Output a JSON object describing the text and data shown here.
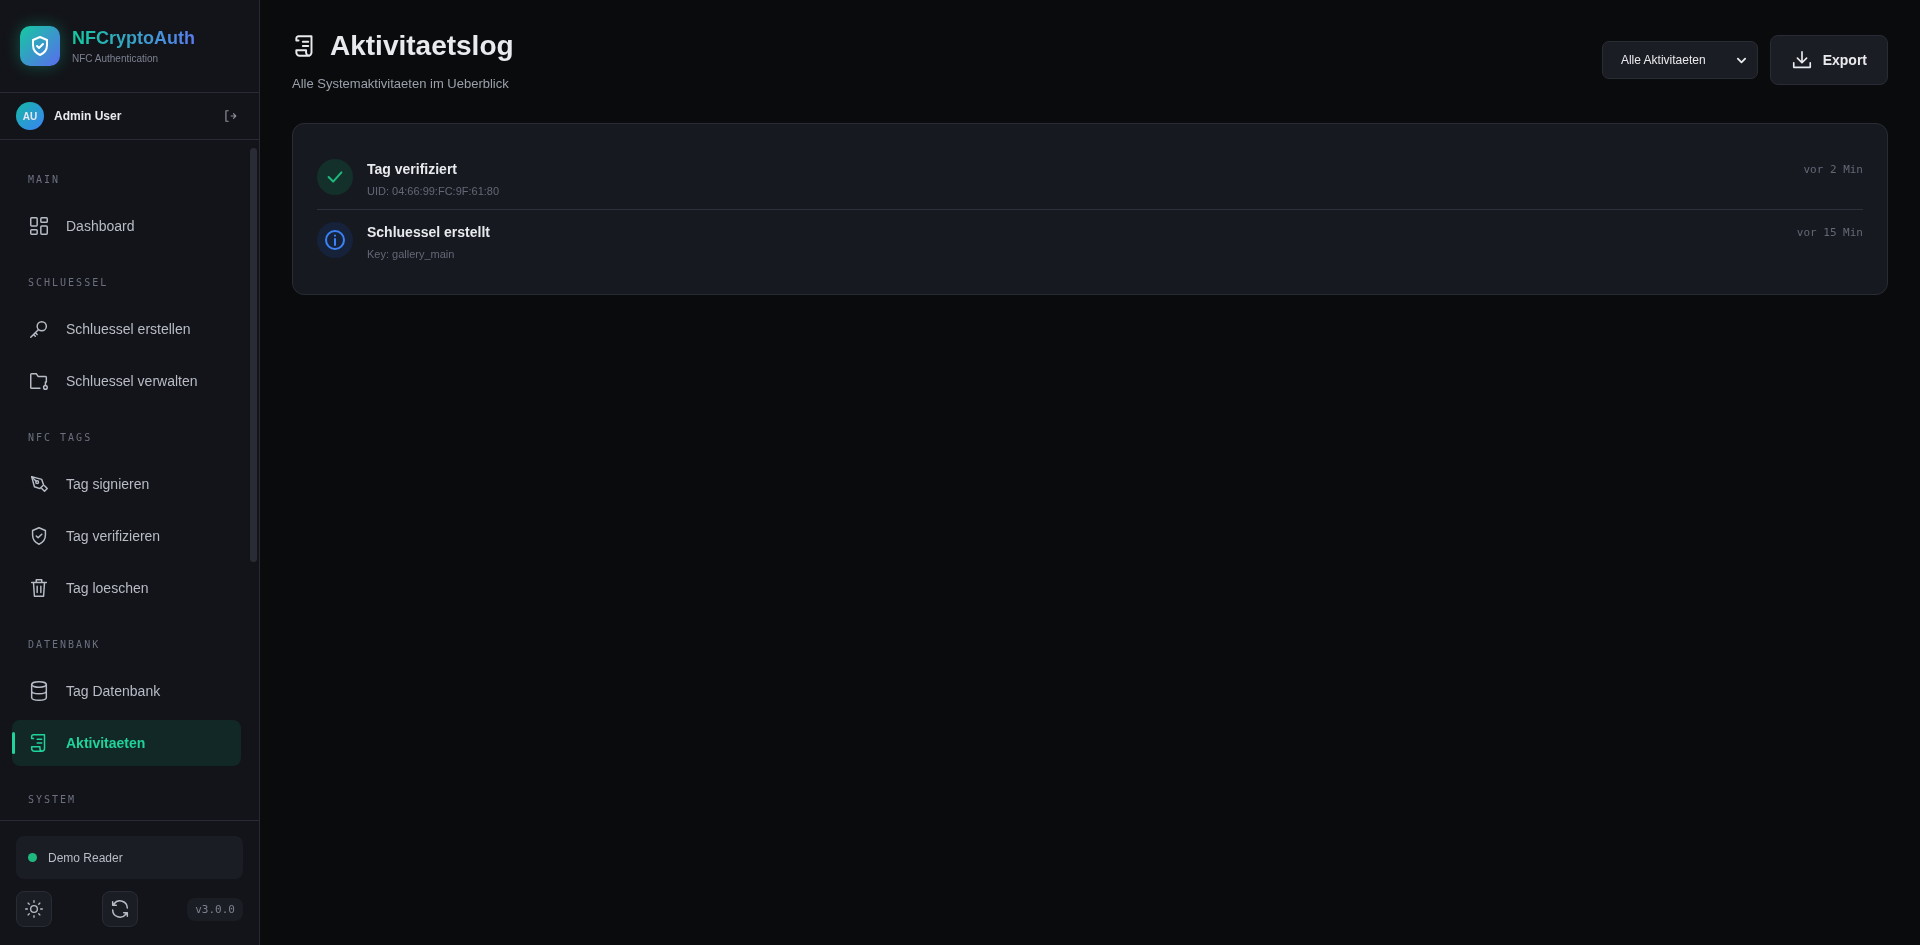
{
  "brand": {
    "name": "NFCryptoAuth",
    "subtitle": "NFC Authentication"
  },
  "user": {
    "initials": "AU",
    "name": "Admin User"
  },
  "nav": [
    {
      "title": "MAIN",
      "items": [
        {
          "label": "Dashboard",
          "selected": false
        }
      ]
    },
    {
      "title": "SCHLUESSEL",
      "items": [
        {
          "label": "Schluessel erstellen",
          "selected": false
        },
        {
          "label": "Schluessel verwalten",
          "selected": false
        }
      ]
    },
    {
      "title": "NFC TAGS",
      "items": [
        {
          "label": "Tag signieren",
          "selected": false
        },
        {
          "label": "Tag verifizieren",
          "selected": false
        },
        {
          "label": "Tag loeschen",
          "selected": false
        }
      ]
    },
    {
      "title": "DATENBANK",
      "items": [
        {
          "label": "Tag Datenbank",
          "selected": false
        },
        {
          "label": "Aktivitaeten",
          "selected": true
        }
      ]
    },
    {
      "title": "SYSTEM"
    }
  ],
  "reader": {
    "name": "Demo Reader",
    "connected": true
  },
  "version": "v3.0.0",
  "page": {
    "title": "Aktivitaetslog",
    "subtitle": "Alle Systemaktivitaeten im Ueberblick",
    "filter": "Alle Aktivitaeten",
    "export": "Export"
  },
  "activities": [
    {
      "kind": "success",
      "title": "Tag verifiziert",
      "detail": "UID: 04:66:99:FC:9F:61:80",
      "time": "vor 2 Min"
    },
    {
      "kind": "info",
      "title": "Schluessel erstellt",
      "detail": "Key: gallery_main",
      "time": "vor 15 Min"
    }
  ]
}
